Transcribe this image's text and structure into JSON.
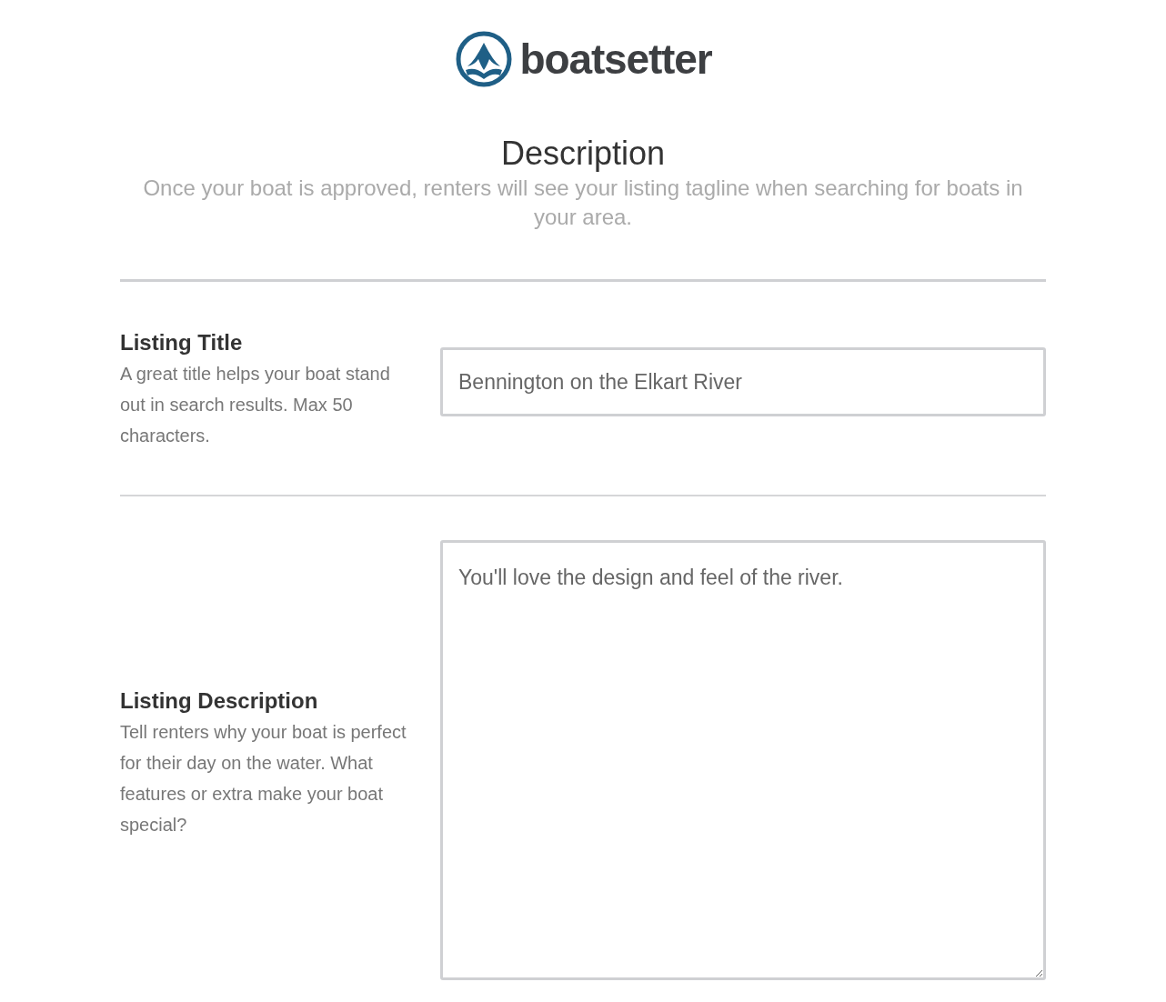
{
  "logo": {
    "text": "boatsetter"
  },
  "heading": "Description",
  "subtitle": "Once your boat is approved, renters will see your listing tagline when searching for boats in your area.",
  "fields": [
    {
      "kind": "input",
      "label": "Listing Title",
      "help": "A great title helps your boat stand out in search results. Max 50 characters.",
      "value": "Bennington on the Elkart River"
    },
    {
      "kind": "textarea",
      "label": "Listing Description",
      "help": "Tell renters why your boat is perfect for their day on the water. What features or extra make your boat special?",
      "value": "You'll love the design and feel of the river."
    }
  ]
}
